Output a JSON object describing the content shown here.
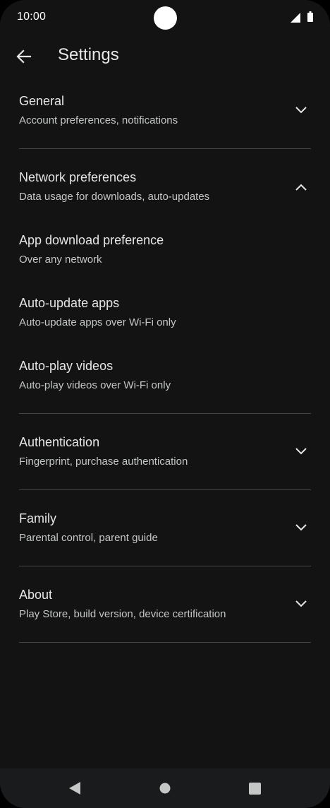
{
  "status_bar": {
    "time": "10:00"
  },
  "header": {
    "title": "Settings",
    "back_icon": "arrow-back-icon"
  },
  "sections": {
    "general": {
      "title": "General",
      "subtitle": "Account preferences, notifications",
      "expanded": false
    },
    "network": {
      "title": "Network preferences",
      "subtitle": "Data usage for downloads, auto-updates",
      "expanded": true,
      "items": [
        {
          "title": "App download preference",
          "subtitle": "Over any network"
        },
        {
          "title": "Auto-update apps",
          "subtitle": "Auto-update apps over Wi-Fi only"
        },
        {
          "title": "Auto-play videos",
          "subtitle": "Auto-play videos over Wi-Fi only"
        }
      ]
    },
    "authentication": {
      "title": "Authentication",
      "subtitle": "Fingerprint, purchase authentication",
      "expanded": false
    },
    "family": {
      "title": "Family",
      "subtitle": "Parental control, parent guide",
      "expanded": false
    },
    "about": {
      "title": "About",
      "subtitle": "Play Store, build version, device certification",
      "expanded": false
    }
  },
  "nav_bar": {
    "icons": [
      "back-triangle-icon",
      "home-circle-icon",
      "recents-square-icon"
    ]
  },
  "colors": {
    "background": "#131314",
    "text_primary": "#e6e6e6",
    "text_secondary": "#c4c7c5",
    "divider": "#444746"
  }
}
